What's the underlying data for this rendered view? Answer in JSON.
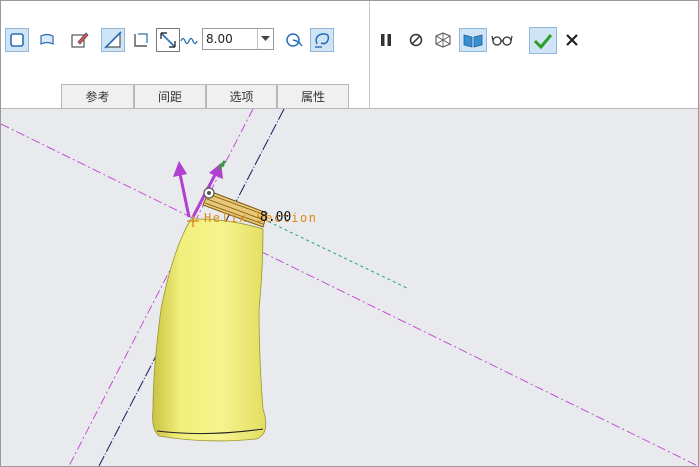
{
  "toolbar": {
    "depth_value": "8.00",
    "depth_placeholder": "",
    "icons": [
      "solid-icon",
      "surface-icon",
      "edit-sketch-icon",
      "remove-material-icon",
      "thicken-icon",
      "flip-direction-icon",
      "depth-options-icon",
      "sketch-plane-icon",
      "feature-options-icon",
      "pause-icon",
      "no-preview-icon",
      "preview-geometry-icon",
      "verify-icon",
      "glasses-preview-icon",
      "ok-check-icon",
      "cancel-x-icon"
    ]
  },
  "tabs": [
    {
      "label": "参考"
    },
    {
      "label": "间距"
    },
    {
      "label": "选项"
    },
    {
      "label": "属性"
    }
  ],
  "viewport": {
    "dimension_label": "8.00",
    "annotation_text": "Helix Section"
  },
  "colors": {
    "accent_active": "#cfe4f5",
    "bottle": "#f0ee7a",
    "datum_line": "#c040d0",
    "axis_line": "#1a1a60",
    "arrow": "#b040d0",
    "dashed_line": "#20a090",
    "ok": "#2aa02a"
  }
}
